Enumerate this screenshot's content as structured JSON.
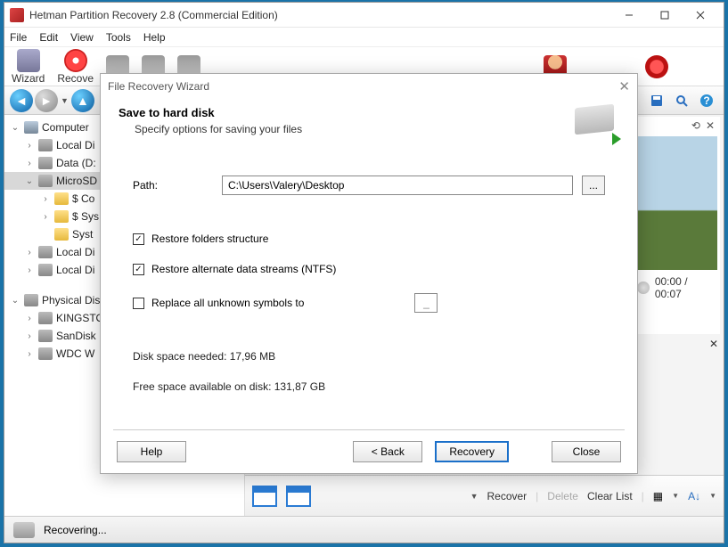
{
  "window": {
    "title": "Hetman Partition Recovery 2.8 (Commercial Edition)"
  },
  "menu": {
    "file": "File",
    "edit": "Edit",
    "view": "View",
    "tools": "Tools",
    "help": "Help"
  },
  "toolbar": {
    "wizard": "Wizard",
    "recover": "Recove"
  },
  "tree": {
    "computer": "Computer",
    "local1": "Local Di",
    "data": "Data (D:",
    "microsd": "MicroSD",
    "sco": "$ Co",
    "ssys": "$ Sys",
    "syst": "Syst",
    "local2": "Local Di",
    "local3": "Local Di",
    "physical": "Physical Dis",
    "kingston": "KINGSTO",
    "sandisk": "SanDisk",
    "wdc": "WDC W"
  },
  "modal": {
    "title": "File Recovery Wizard",
    "heading": "Save to hard disk",
    "subheading": "Specify options for saving your files",
    "path_label": "Path:",
    "path_value": "C:\\Users\\Valery\\Desktop",
    "browse": "...",
    "chk1": "Restore folders structure",
    "chk2": "Restore alternate data streams (NTFS)",
    "chk3": "Replace all unknown symbols to",
    "sym_placeholder": "_",
    "space_needed": "Disk space needed: 17,96 MB",
    "space_free": "Free space available on disk: 131,87 GB",
    "btn_help": "Help",
    "btn_back": "< Back",
    "btn_recovery": "Recovery",
    "btn_close": "Close"
  },
  "preview": {
    "time": "00:00 / 00:07"
  },
  "filebar": {
    "recover": "Recover",
    "delete": "Delete",
    "clear": "Clear List"
  },
  "status": {
    "text": "Recovering..."
  }
}
